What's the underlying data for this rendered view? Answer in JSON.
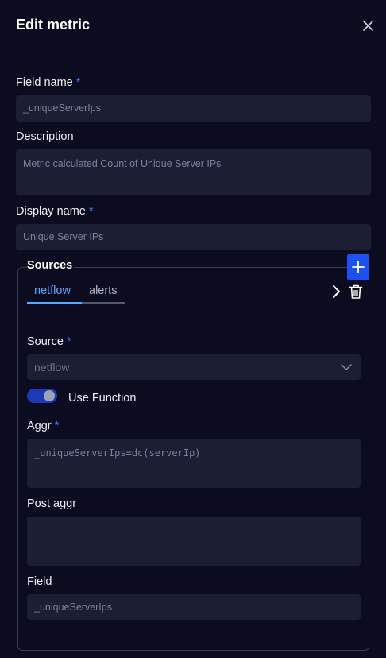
{
  "header": {
    "title": "Edit metric",
    "close_icon": "close-icon"
  },
  "form": {
    "field_name": {
      "label": "Field name",
      "required_mark": "*",
      "value": "_uniqueServerIps"
    },
    "description": {
      "label": "Description",
      "value": "Metric calculated Count of Unique Server IPs"
    },
    "display_name": {
      "label": "Display name",
      "required_mark": "*",
      "value": "Unique Server IPs"
    }
  },
  "sources": {
    "title": "Sources",
    "add_icon": "plus-icon",
    "tabs": [
      {
        "label": "netflow",
        "active": true
      },
      {
        "label": "alerts",
        "active": false
      }
    ],
    "next_icon": "chevron-right-icon",
    "delete_icon": "trash-icon",
    "source": {
      "label": "Source",
      "required_mark": "*",
      "value": "netflow"
    },
    "use_function": {
      "label": "Use Function",
      "enabled": true
    },
    "aggr": {
      "label": "Aggr",
      "required_mark": "*",
      "value": "_uniqueServerIps=dc(serverIp)"
    },
    "post_aggr": {
      "label": "Post aggr",
      "value": ""
    },
    "field": {
      "label": "Field",
      "value": "_uniqueServerIps"
    }
  },
  "colors": {
    "background": "#0b0c20",
    "input_bg": "#1c1e33",
    "accent": "#1c50f2",
    "required": "#3f7bff",
    "active_tab": "#5aa7ff"
  }
}
